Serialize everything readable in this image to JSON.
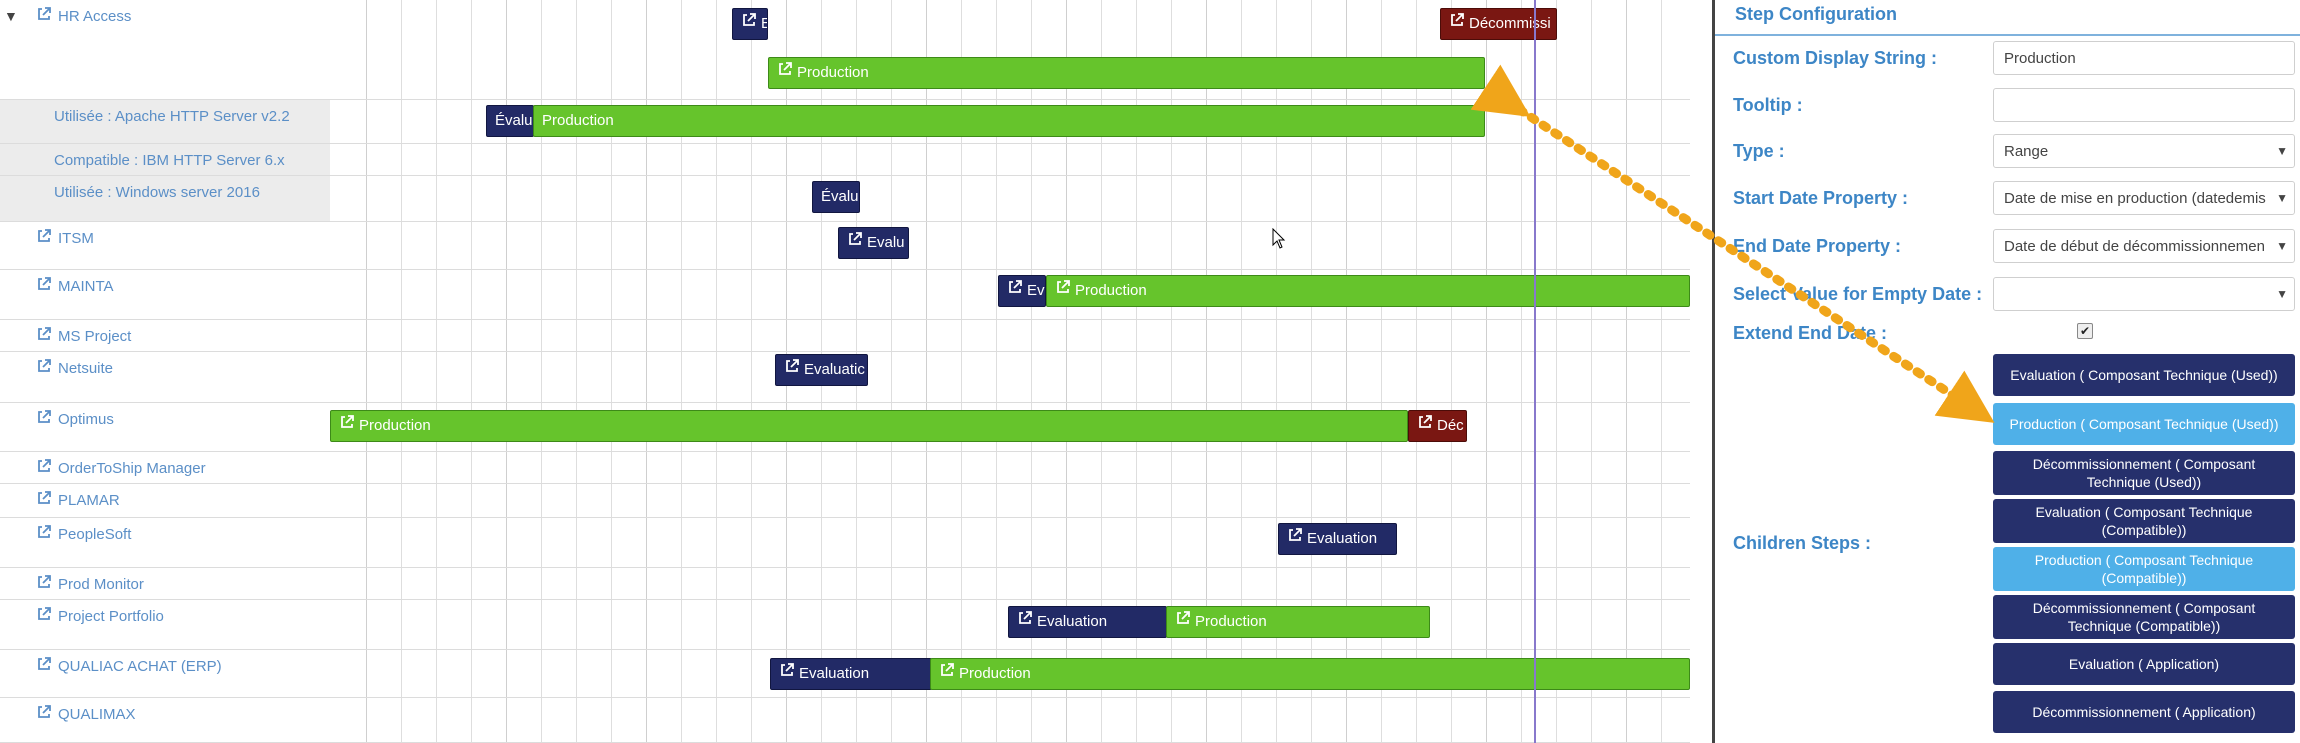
{
  "colors": {
    "evaluation": "#222a66",
    "production": "#66c42c",
    "decommission": "#7a1712",
    "link": "#5b8fc7",
    "accent": "#3d86c6",
    "today_line": "#8878cc",
    "arrow": "#f0a51a"
  },
  "rows": [
    {
      "label": "HR Access",
      "type": "app",
      "expanded": true,
      "icon": "external-link-icon",
      "bars": [
        {
          "kind": "eval",
          "label": "E",
          "icon": true
        },
        {
          "kind": "decom",
          "label": "Décommissi",
          "icon": true
        },
        {
          "kind": "prod",
          "label": "Production",
          "icon": true
        }
      ]
    },
    {
      "label": "Utilisée : Apache HTTP Server v2.2",
      "type": "child",
      "bars": [
        {
          "kind": "eval",
          "label": "Évalu",
          "icon": false
        },
        {
          "kind": "prod",
          "label": "Production",
          "icon": false
        }
      ]
    },
    {
      "label": "Compatible : IBM HTTP Server 6.x",
      "type": "child",
      "bars": []
    },
    {
      "label": "Utilisée : Windows server 2016",
      "type": "child",
      "bars": [
        {
          "kind": "eval",
          "label": "Évalu",
          "icon": false
        }
      ]
    },
    {
      "label": "ITSM",
      "type": "app",
      "bars": [
        {
          "kind": "eval",
          "label": "Evalu",
          "icon": true
        }
      ]
    },
    {
      "label": "MAINTA",
      "type": "app",
      "bars": [
        {
          "kind": "eval",
          "label": "Ev",
          "icon": true
        },
        {
          "kind": "prod",
          "label": "Production",
          "icon": true
        }
      ]
    },
    {
      "label": "MS Project",
      "type": "app",
      "bars": []
    },
    {
      "label": "Netsuite",
      "type": "app",
      "bars": [
        {
          "kind": "eval",
          "label": "Evaluatic",
          "icon": true
        }
      ]
    },
    {
      "label": "Optimus",
      "type": "app",
      "bars": [
        {
          "kind": "prod",
          "label": "Production",
          "icon": true
        },
        {
          "kind": "decom",
          "label": "Déc",
          "icon": true
        }
      ]
    },
    {
      "label": "OrderToShip Manager",
      "type": "app",
      "bars": []
    },
    {
      "label": "PLAMAR",
      "type": "app",
      "bars": []
    },
    {
      "label": "PeopleSoft",
      "type": "app",
      "bars": [
        {
          "kind": "eval",
          "label": "Evaluation",
          "icon": true
        }
      ]
    },
    {
      "label": "Prod Monitor",
      "type": "app",
      "bars": []
    },
    {
      "label": "Project Portfolio",
      "type": "app",
      "bars": [
        {
          "kind": "eval",
          "label": "Evaluation",
          "icon": true
        },
        {
          "kind": "prod",
          "label": "Production",
          "icon": true
        }
      ]
    },
    {
      "label": "QUALIAC ACHAT (ERP)",
      "type": "app",
      "bars": [
        {
          "kind": "eval",
          "label": "Evaluation",
          "icon": true
        },
        {
          "kind": "prod",
          "label": "Production",
          "icon": true
        }
      ]
    },
    {
      "label": "QUALIMAX",
      "type": "app",
      "bars": []
    }
  ],
  "panel": {
    "title": "Step Configuration",
    "custom_display_label": "Custom Display String :",
    "custom_display_value": "Production",
    "tooltip_label": "Tooltip :",
    "tooltip_value": "",
    "type_label": "Type :",
    "type_value": "Range",
    "start_label": "Start Date Property :",
    "start_value": "Date de mise en production (datedemis",
    "end_label": "End Date Property :",
    "end_value": "Date de début de décommissionnemen",
    "empty_label": "Select Value for Empty Date :",
    "empty_value": "",
    "extend_label": "Extend End Date :",
    "extend_checked": true,
    "children_label": "Children Steps :",
    "children": [
      {
        "label": "Evaluation ( Composant Technique (Used))",
        "selected": false
      },
      {
        "label": "Production ( Composant Technique (Used))",
        "selected": true
      },
      {
        "label": "Décommissionnement ( Composant Technique (Used))",
        "selected": false
      },
      {
        "label": "Evaluation ( Composant Technique (Compatible))",
        "selected": false
      },
      {
        "label": "Production ( Composant Technique (Compatible))",
        "selected": true
      },
      {
        "label": "Décommissionnement ( Composant Technique (Compatible))",
        "selected": false
      },
      {
        "label": "Evaluation ( Application)",
        "selected": false
      },
      {
        "label": "Décommissionnement ( Application)",
        "selected": false
      }
    ]
  }
}
